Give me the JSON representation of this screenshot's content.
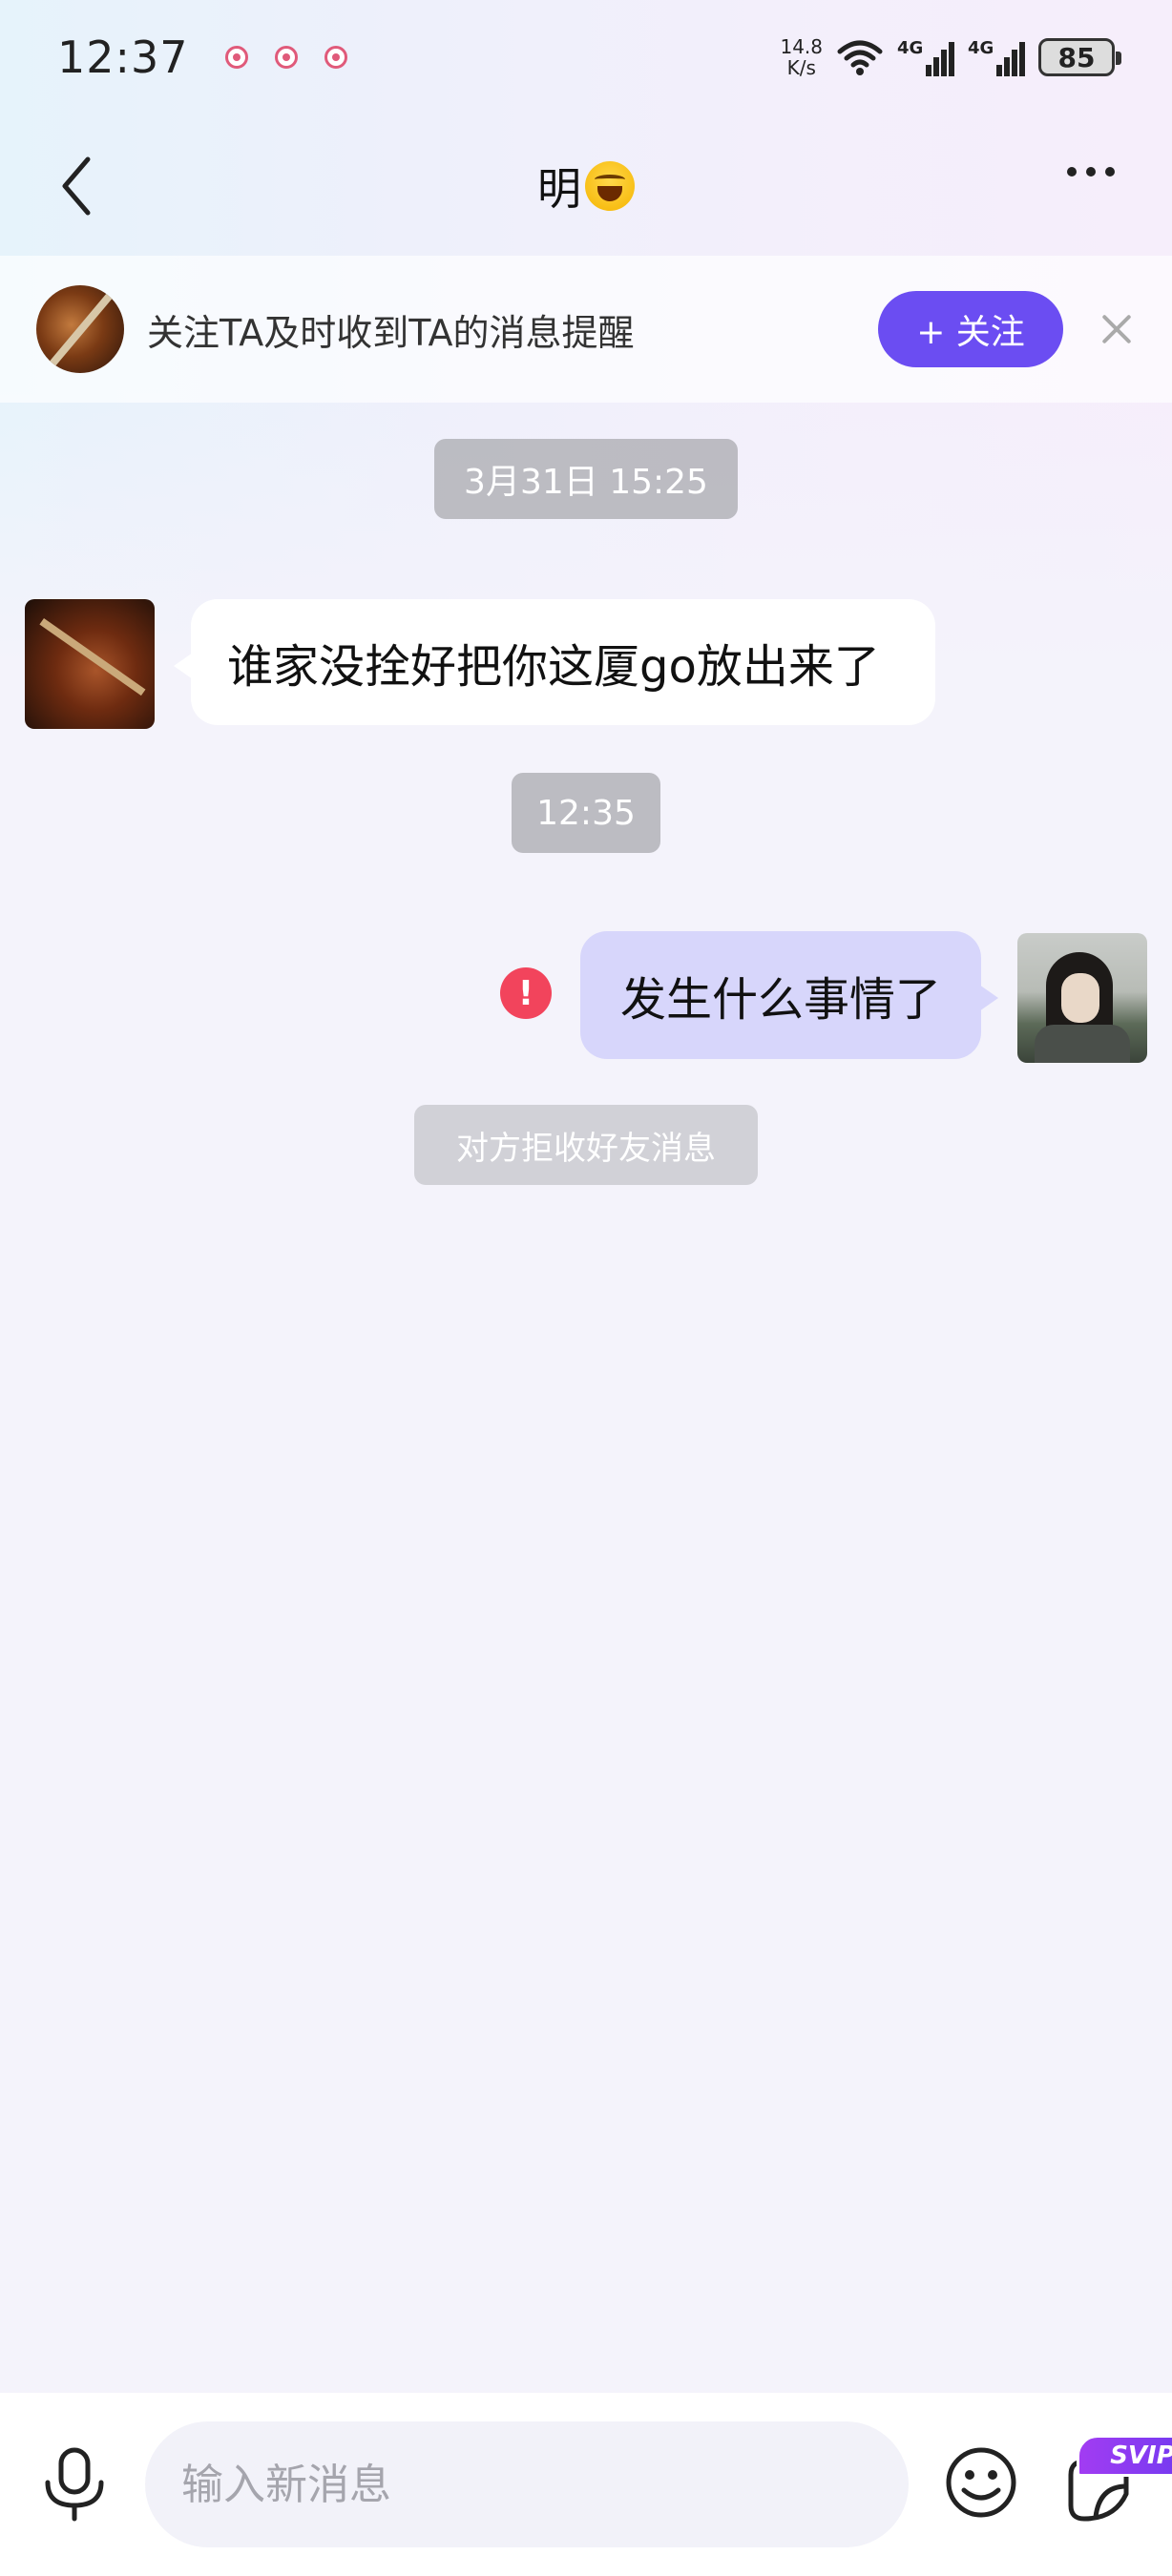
{
  "status_bar": {
    "time": "12:37",
    "net_speed_value": "14.8",
    "net_speed_unit": "K/s",
    "signal_1": "4G",
    "signal_2": "4G",
    "battery": "85"
  },
  "nav": {
    "title": "明"
  },
  "follow_banner": {
    "text": "关注TA及时收到TA的消息提醒",
    "follow_label": "+ 关注"
  },
  "chat": {
    "timestamp_1": "3月31日 15:25",
    "message_left": "谁家没拴好把你这厦go放出来了",
    "timestamp_2": "12:35",
    "message_right": "发生什么事情了",
    "send_error_icon": "!",
    "system_notice": "对方拒收好友消息"
  },
  "input_bar": {
    "placeholder": "输入新消息",
    "svip_badge": "SVIP"
  },
  "colors": {
    "accent": "#6b4df2",
    "bubble_self": "#d7d6fb",
    "error": "#f2445c"
  }
}
